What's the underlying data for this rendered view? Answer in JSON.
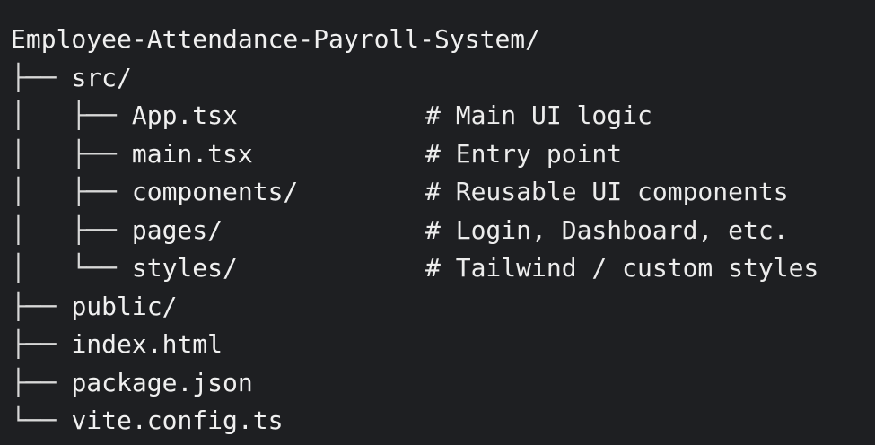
{
  "tree": {
    "root": "Employee-Attendance-Payroll-System/",
    "entries": [
      {
        "prefix": "├── ",
        "name": "src/",
        "comment": ""
      },
      {
        "prefix": "│   ├── ",
        "name": "App.tsx",
        "comment": "# Main UI logic"
      },
      {
        "prefix": "│   ├── ",
        "name": "main.tsx",
        "comment": "# Entry point"
      },
      {
        "prefix": "│   ├── ",
        "name": "components/",
        "comment": "# Reusable UI components"
      },
      {
        "prefix": "│   ├── ",
        "name": "pages/",
        "comment": "# Login, Dashboard, etc."
      },
      {
        "prefix": "│   └── ",
        "name": "styles/",
        "comment": "# Tailwind / custom styles"
      },
      {
        "prefix": "├── ",
        "name": "public/",
        "comment": ""
      },
      {
        "prefix": "├── ",
        "name": "index.html",
        "comment": ""
      },
      {
        "prefix": "├── ",
        "name": "package.json",
        "comment": ""
      },
      {
        "prefix": "└── ",
        "name": "vite.config.ts",
        "comment": ""
      }
    ]
  },
  "theme": {
    "background": "#1e1f22",
    "text": "#e8e8e8"
  }
}
